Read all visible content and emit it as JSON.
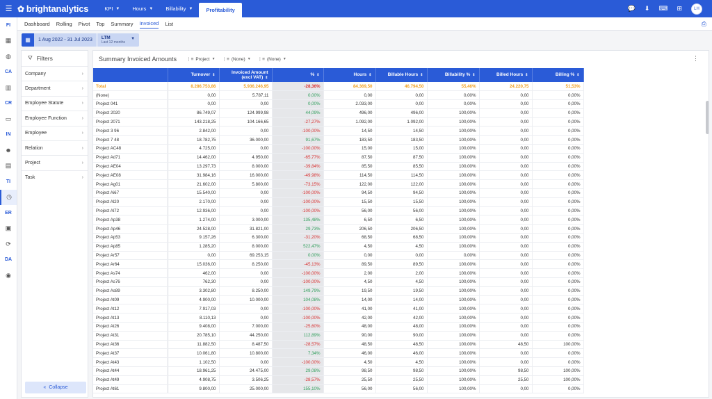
{
  "app": {
    "logo": "brightanalytics",
    "nav": [
      {
        "label": "KPI",
        "active": false
      },
      {
        "label": "Hours",
        "active": false
      },
      {
        "label": "Billability",
        "active": false
      },
      {
        "label": "Profitability",
        "active": true
      }
    ],
    "user_initials": "LH",
    "top_icons": [
      "chat-icon",
      "download-icon",
      "keyboard-icon",
      "grid-icon"
    ]
  },
  "rail": [
    "FI",
    "grid-icon",
    "globe-icon",
    "CA",
    "building-icon",
    "CR",
    "money-icon",
    "IN",
    "face-icon",
    "document-icon",
    "TI",
    "clock-icon",
    "ER",
    "report-icon",
    "refresh-icon",
    "DA",
    "gauge-icon"
  ],
  "subtabs": [
    {
      "label": "Dashboard",
      "active": false
    },
    {
      "label": "Rolling",
      "active": false
    },
    {
      "label": "Pivot",
      "active": false
    },
    {
      "label": "Top",
      "active": false
    },
    {
      "label": "Summary",
      "active": false
    },
    {
      "label": "Invoiced",
      "active": true
    },
    {
      "label": "List",
      "active": false
    }
  ],
  "date": {
    "range": "1 Aug 2022 - 31 Jul 2023",
    "period": "LTM",
    "period_sub": "Last 12 months"
  },
  "filters": {
    "title": "Filters",
    "items": [
      "Company",
      "Department",
      "Employee Statute",
      "Employee Function",
      "Employee",
      "Relation",
      "Project",
      "Task"
    ],
    "collapse_label": "Collapse"
  },
  "panel": {
    "title": "Summary Invoiced Amounts",
    "groupings": [
      "Project",
      "(None)",
      "(None)"
    ]
  },
  "table": {
    "columns": [
      "",
      "Turnover",
      "Invoiced Amount (excl VAT)",
      "%",
      "Hours",
      "Billable Hours",
      "Billability %",
      "Billed Hours",
      "Billing %"
    ],
    "rows": [
      [
        "Total",
        "8.286.753,86",
        "5.936.246,95",
        "-28,36%",
        "84.369,50",
        "46.794,50",
        "55,46%",
        "24.220,75",
        "51,53%"
      ],
      [
        "(None)",
        "0,00",
        "5.787,11",
        "0,00%",
        "0,00",
        "0,00",
        "0,00%",
        "0,00",
        "0,00%"
      ],
      [
        "Project 041",
        "0,00",
        "0,00",
        "0,00%",
        "2.033,00",
        "0,00",
        "0,00%",
        "0,00",
        "0,00%"
      ],
      [
        "Project 2020",
        "86.749,07",
        "124.999,98",
        "44,09%",
        "496,00",
        "496,00",
        "100,00%",
        "0,00",
        "0,00%"
      ],
      [
        "Project 2071",
        "143.218,25",
        "104.166,65",
        "-27,27%",
        "1.092,00",
        "1.092,00",
        "100,00%",
        "0,00",
        "0,00%"
      ],
      [
        "Project 3 96",
        "2.842,00",
        "0,00",
        "-100,00%",
        "14,50",
        "14,50",
        "100,00%",
        "0,00",
        "0,00%"
      ],
      [
        "Project 7 48",
        "18.782,75",
        "36.000,00",
        "91,67%",
        "183,50",
        "183,50",
        "100,00%",
        "0,00",
        "0,00%"
      ],
      [
        "Project AC48",
        "4.725,00",
        "0,00",
        "-100,00%",
        "15,00",
        "15,00",
        "100,00%",
        "0,00",
        "0,00%"
      ],
      [
        "Project Ad71",
        "14.462,00",
        "4.950,00",
        "-65,77%",
        "87,50",
        "87,50",
        "100,00%",
        "0,00",
        "0,00%"
      ],
      [
        "Project AE04",
        "13.297,73",
        "8.000,00",
        "-39,84%",
        "85,50",
        "85,50",
        "100,00%",
        "0,00",
        "0,00%"
      ],
      [
        "Project AE08",
        "31.984,16",
        "16.000,00",
        "-49,98%",
        "114,50",
        "114,50",
        "100,00%",
        "0,00",
        "0,00%"
      ],
      [
        "Project Ag01",
        "21.602,00",
        "5.800,00",
        "-73,15%",
        "122,00",
        "122,00",
        "100,00%",
        "0,00",
        "0,00%"
      ],
      [
        "Project Ai67",
        "15.540,00",
        "0,00",
        "-100,00%",
        "94,50",
        "94,50",
        "100,00%",
        "0,00",
        "0,00%"
      ],
      [
        "Project Al20",
        "2.170,00",
        "0,00",
        "-100,00%",
        "15,50",
        "15,50",
        "100,00%",
        "0,00",
        "0,00%"
      ],
      [
        "Project Al72",
        "12.936,00",
        "0,00",
        "-100,00%",
        "56,00",
        "56,00",
        "100,00%",
        "0,00",
        "0,00%"
      ],
      [
        "Project Ap38",
        "1.274,00",
        "3.000,00",
        "135,48%",
        "6,50",
        "6,50",
        "100,00%",
        "0,00",
        "0,00%"
      ],
      [
        "Project Ap46",
        "24.528,00",
        "31.821,00",
        "29,73%",
        "206,50",
        "206,50",
        "100,00%",
        "0,00",
        "0,00%"
      ],
      [
        "Project Ap53",
        "9.157,26",
        "6.300,00",
        "-31,20%",
        "68,50",
        "68,50",
        "100,00%",
        "0,00",
        "0,00%"
      ],
      [
        "Project Ap85",
        "1.285,20",
        "8.000,00",
        "522,47%",
        "4,50",
        "4,50",
        "100,00%",
        "0,00",
        "0,00%"
      ],
      [
        "Project Ar57",
        "0,00",
        "69.253,15",
        "0,00%",
        "0,00",
        "0,00",
        "0,00%",
        "0,00",
        "0,00%"
      ],
      [
        "Project Ar64",
        "15.036,00",
        "8.250,00",
        "-45,13%",
        "89,50",
        "89,50",
        "100,00%",
        "0,00",
        "0,00%"
      ],
      [
        "Project As74",
        "462,00",
        "0,00",
        "-100,00%",
        "2,00",
        "2,00",
        "100,00%",
        "0,00",
        "0,00%"
      ],
      [
        "Project As76",
        "762,30",
        "0,00",
        "-100,00%",
        "4,50",
        "4,50",
        "100,00%",
        "0,00",
        "0,00%"
      ],
      [
        "Project As89",
        "3.302,80",
        "8.250,00",
        "149,79%",
        "19,50",
        "19,50",
        "100,00%",
        "0,00",
        "0,00%"
      ],
      [
        "Project At09",
        "4.900,00",
        "10.000,00",
        "104,08%",
        "14,00",
        "14,00",
        "100,00%",
        "0,00",
        "0,00%"
      ],
      [
        "Project At12",
        "7.917,03",
        "0,00",
        "-100,00%",
        "41,00",
        "41,00",
        "100,00%",
        "0,00",
        "0,00%"
      ],
      [
        "Project At13",
        "8.110,13",
        "0,00",
        "-100,00%",
        "42,00",
        "42,00",
        "100,00%",
        "0,00",
        "0,00%"
      ],
      [
        "Project At26",
        "9.408,00",
        "7.000,00",
        "-25,60%",
        "48,00",
        "48,00",
        "100,00%",
        "0,00",
        "0,00%"
      ],
      [
        "Project At31",
        "20.785,10",
        "44.250,00",
        "112,89%",
        "90,00",
        "90,00",
        "100,00%",
        "0,00",
        "0,00%"
      ],
      [
        "Project At36",
        "11.882,50",
        "8.487,50",
        "-28,57%",
        "48,50",
        "48,50",
        "100,00%",
        "48,50",
        "100,00%"
      ],
      [
        "Project At37",
        "10.061,80",
        "10.800,00",
        "7,34%",
        "46,00",
        "46,00",
        "100,00%",
        "0,00",
        "0,00%"
      ],
      [
        "Project At43",
        "1.102,50",
        "0,00",
        "-100,00%",
        "4,50",
        "4,50",
        "100,00%",
        "0,00",
        "0,00%"
      ],
      [
        "Project At44",
        "18.961,25",
        "24.475,00",
        "29,08%",
        "98,50",
        "98,50",
        "100,00%",
        "98,50",
        "100,00%"
      ],
      [
        "Project At49",
        "4.908,75",
        "3.506,25",
        "-28,57%",
        "25,50",
        "25,50",
        "100,00%",
        "25,50",
        "100,00%"
      ],
      [
        "Project At61",
        "9.800,00",
        "25.000,00",
        "155,10%",
        "56,00",
        "56,00",
        "100,00%",
        "0,00",
        "0,00%"
      ]
    ]
  }
}
